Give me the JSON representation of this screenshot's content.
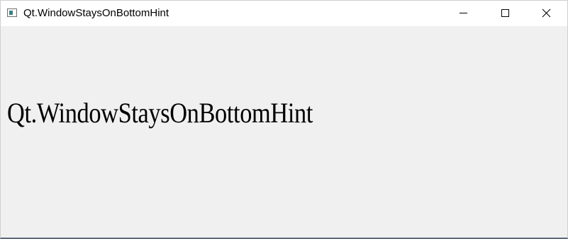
{
  "window": {
    "title": "Qt.WindowStaysOnBottomHint",
    "app_icon": "qt-window-icon",
    "controls": {
      "minimize_icon": "minimize-icon",
      "maximize_icon": "maximize-icon",
      "close_icon": "close-icon"
    }
  },
  "content": {
    "label": "Qt.WindowStaysOnBottomHint"
  },
  "colors": {
    "titlebar_bg": "#ffffff",
    "content_bg": "#f0f0f0",
    "text": "#000000"
  }
}
